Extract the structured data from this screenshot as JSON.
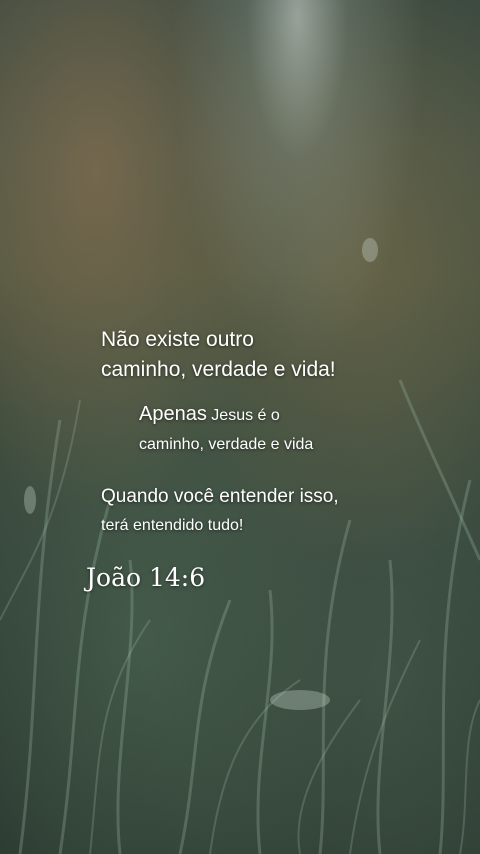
{
  "quote": {
    "line1": "Não existe outro",
    "line2": "caminho, verdade e vida!",
    "line3_lead": "Apenas",
    "line3_rest": " Jesus é o",
    "line4": "caminho, verdade e vida",
    "line5": "Quando você entender isso,",
    "line6": "terá entendido tudo!",
    "reference": "João 14:6"
  },
  "colors": {
    "text": "#ffffff",
    "background_dark": "#2b3a2f",
    "grass_green": "#5f7a63"
  }
}
